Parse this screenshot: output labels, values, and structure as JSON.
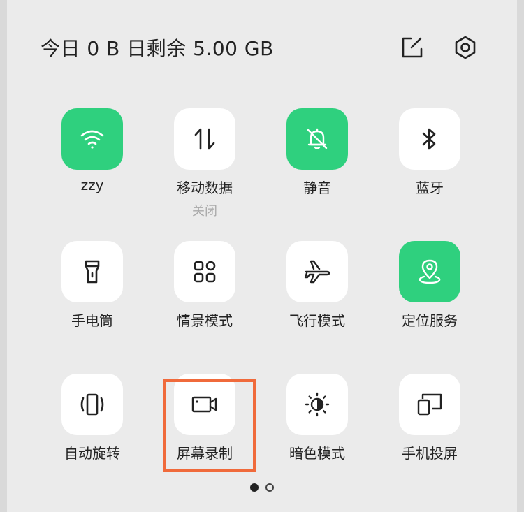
{
  "header": {
    "usage_text": "今日 0 B  日剩余 5.00 GB",
    "edit_icon": "edit-icon",
    "settings_icon": "settings-icon"
  },
  "colors": {
    "active_tile": "#2fd07e",
    "inactive_tile": "#ffffff",
    "highlight_border": "#f06a3b"
  },
  "tiles": [
    {
      "label": "zzy",
      "icon": "wifi-icon",
      "active": true
    },
    {
      "label": "移动数据",
      "sublabel": "关闭",
      "icon": "mobile-data-icon",
      "active": false
    },
    {
      "label": "静音",
      "icon": "bell-off-icon",
      "active": true
    },
    {
      "label": "蓝牙",
      "icon": "bluetooth-icon",
      "active": false
    },
    {
      "label": "手电筒",
      "icon": "flashlight-icon",
      "active": false
    },
    {
      "label": "情景模式",
      "icon": "grid-icon",
      "active": false
    },
    {
      "label": "飞行模式",
      "icon": "airplane-icon",
      "active": false
    },
    {
      "label": "定位服务",
      "icon": "location-icon",
      "active": true
    },
    {
      "label": "自动旋转",
      "icon": "rotate-icon",
      "active": false
    },
    {
      "label": "屏幕录制",
      "icon": "screen-record-icon",
      "active": false,
      "highlighted": true
    },
    {
      "label": "暗色模式",
      "icon": "dark-mode-icon",
      "active": false
    },
    {
      "label": "手机投屏",
      "icon": "screen-cast-icon",
      "active": false
    }
  ],
  "pagination": {
    "current": 1,
    "total": 2
  }
}
